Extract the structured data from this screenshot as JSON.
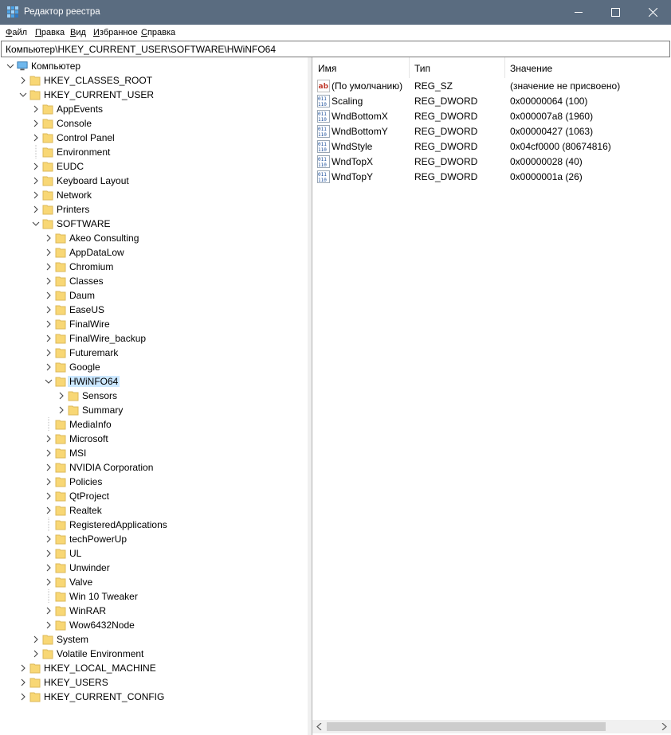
{
  "window": {
    "title": "Редактор реестра",
    "title_color": "#5a6c80"
  },
  "menu": [
    {
      "first": "Ф",
      "rest": "айл"
    },
    {
      "first": "П",
      "rest": "равка"
    },
    {
      "first": "В",
      "rest": "ид"
    },
    {
      "first": "И",
      "rest": "збранное"
    },
    {
      "first": "С",
      "rest": "правка"
    }
  ],
  "address": "Компьютер\\HKEY_CURRENT_USER\\SOFTWARE\\HWiNFO64",
  "tree": [
    {
      "label": "Компьютер",
      "level": 0,
      "type": "computer",
      "expanded": true
    },
    {
      "label": "HKEY_CLASSES_ROOT",
      "level": 1,
      "type": "folder",
      "expanded": false
    },
    {
      "label": "HKEY_CURRENT_USER",
      "level": 1,
      "type": "folder",
      "expanded": true
    },
    {
      "label": "AppEvents",
      "level": 2,
      "type": "folder",
      "expanded": false
    },
    {
      "label": "Console",
      "level": 2,
      "type": "folder",
      "expanded": false
    },
    {
      "label": "Control Panel",
      "level": 2,
      "type": "folder",
      "expanded": false
    },
    {
      "label": "Environment",
      "level": 2,
      "type": "folder",
      "leaf": true
    },
    {
      "label": "EUDC",
      "level": 2,
      "type": "folder",
      "expanded": false
    },
    {
      "label": "Keyboard Layout",
      "level": 2,
      "type": "folder",
      "expanded": false
    },
    {
      "label": "Network",
      "level": 2,
      "type": "folder",
      "expanded": false
    },
    {
      "label": "Printers",
      "level": 2,
      "type": "folder",
      "expanded": false
    },
    {
      "label": "SOFTWARE",
      "level": 2,
      "type": "folder",
      "expanded": true
    },
    {
      "label": "Akeo Consulting",
      "level": 3,
      "type": "folder",
      "expanded": false
    },
    {
      "label": "AppDataLow",
      "level": 3,
      "type": "folder",
      "expanded": false
    },
    {
      "label": "Chromium",
      "level": 3,
      "type": "folder",
      "expanded": false
    },
    {
      "label": "Classes",
      "level": 3,
      "type": "folder",
      "expanded": false
    },
    {
      "label": "Daum",
      "level": 3,
      "type": "folder",
      "expanded": false
    },
    {
      "label": "EaseUS",
      "level": 3,
      "type": "folder",
      "expanded": false
    },
    {
      "label": "FinalWire",
      "level": 3,
      "type": "folder",
      "expanded": false
    },
    {
      "label": "FinalWire_backup",
      "level": 3,
      "type": "folder",
      "expanded": false
    },
    {
      "label": "Futuremark",
      "level": 3,
      "type": "folder",
      "expanded": false
    },
    {
      "label": "Google",
      "level": 3,
      "type": "folder",
      "expanded": false
    },
    {
      "label": "HWiNFO64",
      "level": 3,
      "type": "folder",
      "expanded": true,
      "selected": true
    },
    {
      "label": "Sensors",
      "level": 4,
      "type": "folder",
      "expanded": false
    },
    {
      "label": "Summary",
      "level": 4,
      "type": "folder",
      "expanded": false
    },
    {
      "label": "MediaInfo",
      "level": 3,
      "type": "folder",
      "leaf": true
    },
    {
      "label": "Microsoft",
      "level": 3,
      "type": "folder",
      "expanded": false
    },
    {
      "label": "MSI",
      "level": 3,
      "type": "folder",
      "expanded": false
    },
    {
      "label": "NVIDIA Corporation",
      "level": 3,
      "type": "folder",
      "expanded": false
    },
    {
      "label": "Policies",
      "level": 3,
      "type": "folder",
      "expanded": false
    },
    {
      "label": "QtProject",
      "level": 3,
      "type": "folder",
      "expanded": false
    },
    {
      "label": "Realtek",
      "level": 3,
      "type": "folder",
      "expanded": false
    },
    {
      "label": "RegisteredApplications",
      "level": 3,
      "type": "folder",
      "leaf": true
    },
    {
      "label": "techPowerUp",
      "level": 3,
      "type": "folder",
      "expanded": false
    },
    {
      "label": "UL",
      "level": 3,
      "type": "folder",
      "expanded": false
    },
    {
      "label": "Unwinder",
      "level": 3,
      "type": "folder",
      "expanded": false
    },
    {
      "label": "Valve",
      "level": 3,
      "type": "folder",
      "expanded": false
    },
    {
      "label": "Win 10 Tweaker",
      "level": 3,
      "type": "folder",
      "leaf": true
    },
    {
      "label": "WinRAR",
      "level": 3,
      "type": "folder",
      "expanded": false
    },
    {
      "label": "Wow6432Node",
      "level": 3,
      "type": "folder",
      "expanded": false
    },
    {
      "label": "System",
      "level": 2,
      "type": "folder",
      "expanded": false
    },
    {
      "label": "Volatile Environment",
      "level": 2,
      "type": "folder",
      "expanded": false
    },
    {
      "label": "HKEY_LOCAL_MACHINE",
      "level": 1,
      "type": "folder",
      "expanded": false
    },
    {
      "label": "HKEY_USERS",
      "level": 1,
      "type": "folder",
      "expanded": false
    },
    {
      "label": "HKEY_CURRENT_CONFIG",
      "level": 1,
      "type": "folder",
      "expanded": false
    }
  ],
  "columns": {
    "name": "Имя",
    "type": "Тип",
    "value": "Значение"
  },
  "values": [
    {
      "icon": "string-value-icon",
      "name": "(По умолчанию)",
      "type": "REG_SZ",
      "data": "(значение не присвоено)"
    },
    {
      "icon": "dword-value-icon",
      "name": "Scaling",
      "type": "REG_DWORD",
      "data": "0x00000064 (100)"
    },
    {
      "icon": "dword-value-icon",
      "name": "WndBottomX",
      "type": "REG_DWORD",
      "data": "0x000007a8 (1960)"
    },
    {
      "icon": "dword-value-icon",
      "name": "WndBottomY",
      "type": "REG_DWORD",
      "data": "0x00000427 (1063)"
    },
    {
      "icon": "dword-value-icon",
      "name": "WndStyle",
      "type": "REG_DWORD",
      "data": "0x04cf0000 (80674816)"
    },
    {
      "icon": "dword-value-icon",
      "name": "WndTopX",
      "type": "REG_DWORD",
      "data": "0x00000028 (40)"
    },
    {
      "icon": "dword-value-icon",
      "name": "WndTopY",
      "type": "REG_DWORD",
      "data": "0x0000001a (26)"
    }
  ],
  "colors": {
    "selection": "#cce8ff",
    "folder": "#f8d775",
    "folder_edge": "#dcb95a"
  }
}
